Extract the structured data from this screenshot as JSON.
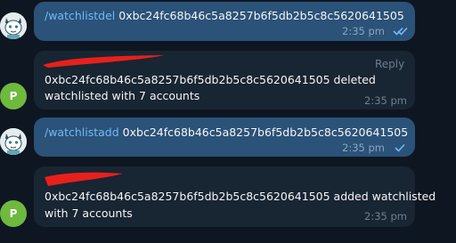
{
  "messages": [
    {
      "command": "/watchlistdel",
      "text": " 0xbc24fc68b46c5a8257b6f5db2b5c8c5620641505",
      "time": "2:35 pm",
      "status": "read"
    },
    {
      "avatar_letter": "P",
      "reply_label": "Reply",
      "line1": "0xbc24fc68b46c5a8257b6f5db2b5c8c5620641505 deleted",
      "line2": "watchlisted with 7 accounts",
      "time": "2:35 pm"
    },
    {
      "command": "/watchlistadd",
      "text": " 0xbc24fc68b46c5a8257b6f5db2b5c8c5620641505",
      "time": "2:35 pm",
      "status": "sent"
    },
    {
      "avatar_letter": "P",
      "line1": "0xbc24fc68b46c5a8257b6f5db2b5c8c5620641505 added watchlisted",
      "line2": "with 7 accounts",
      "time": "2:35 pm"
    }
  ],
  "colors": {
    "background": "#0e1621",
    "outgoing_bubble": "#2b5278",
    "incoming_bubble": "#182533",
    "command_link": "#73b9f5",
    "avatar_p": "#6fb93e",
    "redaction": "#e8201b"
  },
  "icons": [
    "bot-avatar-icon",
    "double-check-icon",
    "single-check-icon",
    "redaction-mark"
  ]
}
